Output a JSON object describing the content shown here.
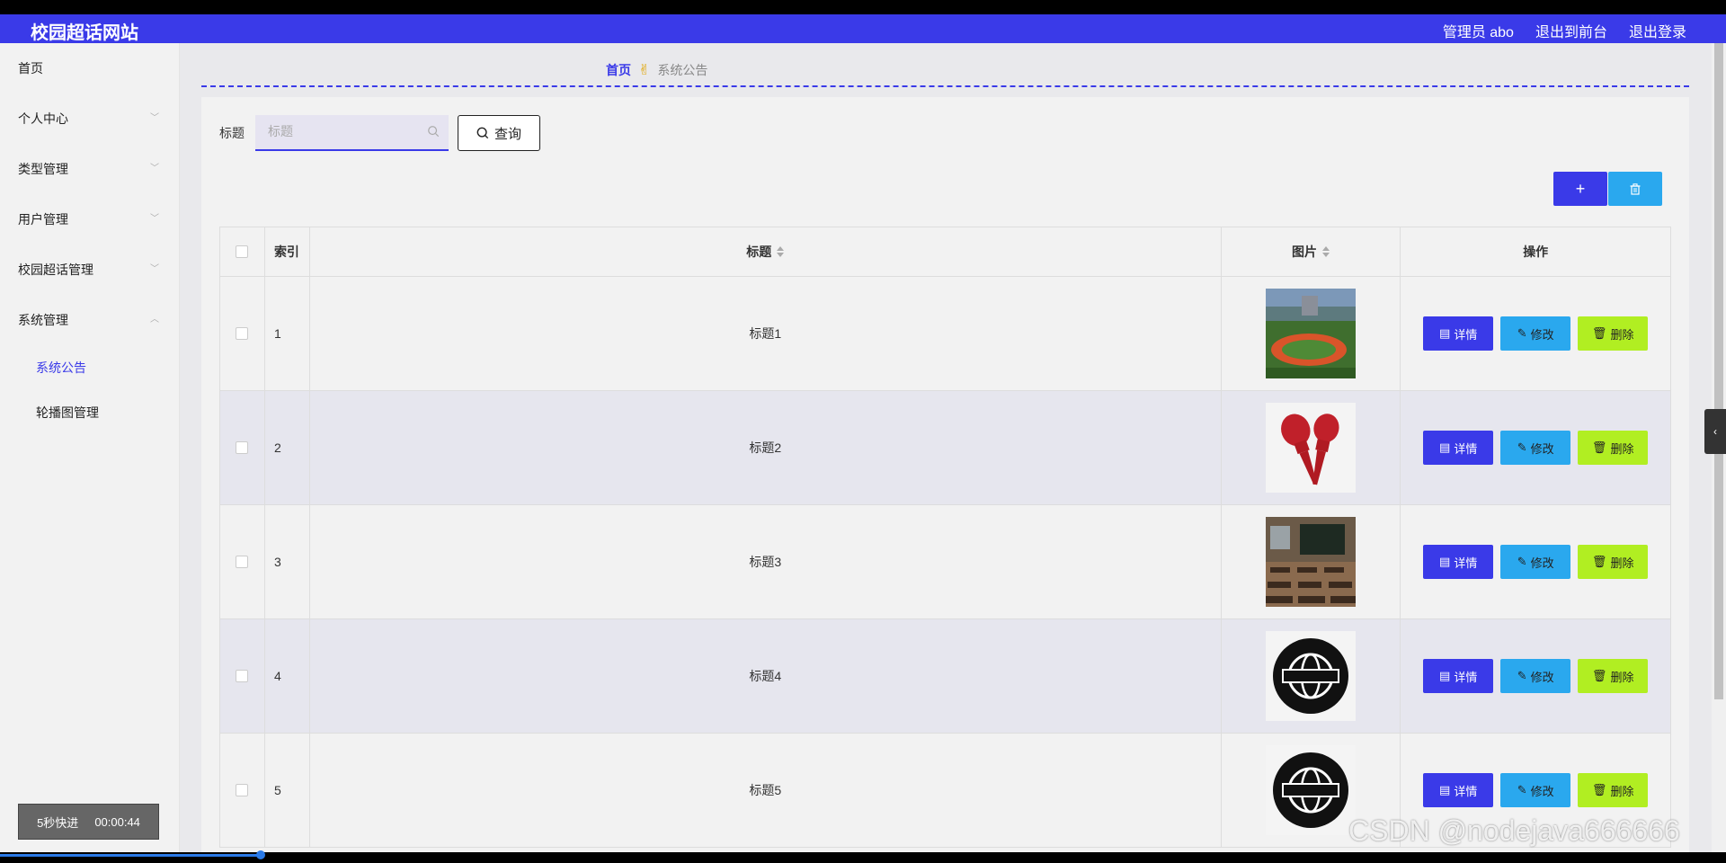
{
  "header": {
    "logo": "校园超话网站",
    "admin": "管理员 abo",
    "front": "退出到前台",
    "logout": "退出登录",
    "bg_color": "#3a3ae8"
  },
  "sidebar": {
    "items": [
      {
        "label": "首页"
      },
      {
        "label": "个人中心"
      },
      {
        "label": "类型管理"
      },
      {
        "label": "用户管理"
      },
      {
        "label": "校园超话管理"
      },
      {
        "label": "系统管理"
      }
    ],
    "sub_items": [
      {
        "label": "系统公告",
        "active": true
      },
      {
        "label": "轮播图管理",
        "active": false
      }
    ],
    "timer_label": "5秒快进",
    "timer_value": "00:00:44"
  },
  "breadcrumb": {
    "home": "首页",
    "current": "系统公告"
  },
  "search": {
    "label": "标题",
    "placeholder": "标题",
    "value": "",
    "query_label": "查询"
  },
  "actions": {
    "add_icon": "plus-icon",
    "bulk_delete_icon": "trash-icon"
  },
  "table": {
    "columns": {
      "index": "索引",
      "title": "标题",
      "image": "图片",
      "ops": "操作"
    },
    "rows": [
      {
        "index": "1",
        "title": "标题1",
        "image": "campus-field"
      },
      {
        "index": "2",
        "title": "标题2",
        "image": "microphones-live"
      },
      {
        "index": "3",
        "title": "标题3",
        "image": "classroom"
      },
      {
        "index": "4",
        "title": "标题4",
        "image": "news-globe"
      },
      {
        "index": "5",
        "title": "标题5",
        "image": "news-globe"
      }
    ],
    "op_labels": {
      "detail": "详情",
      "edit": "修改",
      "delete": "删除"
    }
  },
  "watermark": "CSDN @nodejava666666",
  "colors": {
    "primary": "#3a3ae8",
    "edit": "#2aa8ee",
    "delete": "#b1ee22"
  }
}
